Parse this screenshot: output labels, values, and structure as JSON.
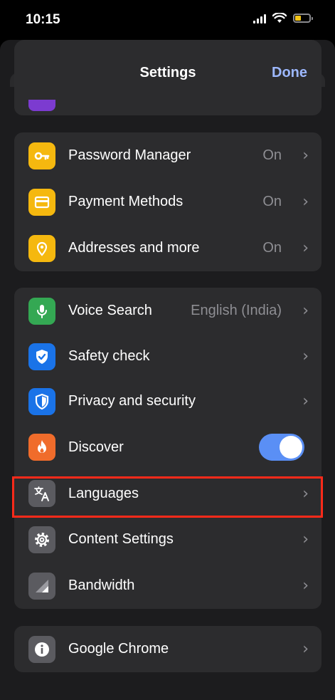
{
  "status_bar": {
    "time": "10:15",
    "battery_color": "#f5c518"
  },
  "nav": {
    "title": "Settings",
    "done_label": "Done"
  },
  "colors": {
    "sheet": "#1c1c1e",
    "group": "#2c2c2e",
    "accent": "#9db8ff",
    "highlight": "#ff2a1a"
  },
  "groups": [
    {
      "rows": [
        {
          "label": "Password Manager",
          "value": "On",
          "icon": "key-icon",
          "icon_color": "#f5b80f"
        },
        {
          "label": "Payment Methods",
          "value": "On",
          "icon": "credit-card-icon",
          "icon_color": "#f5b80f"
        },
        {
          "label": "Addresses and more",
          "value": "On",
          "icon": "location-pin-icon",
          "icon_color": "#f5b80f"
        }
      ]
    },
    {
      "rows": [
        {
          "label": "Voice Search",
          "value": "English (India)",
          "icon": "microphone-icon",
          "icon_color": "#34a853"
        },
        {
          "label": "Safety check",
          "value": "",
          "icon": "shield-check-icon",
          "icon_color": "#1a73e8"
        },
        {
          "label": "Privacy and security",
          "value": "",
          "icon": "shield-icon",
          "icon_color": "#1a73e8"
        },
        {
          "label": "Discover",
          "value": "",
          "icon": "flame-icon",
          "icon_color": "#f06c2b",
          "toggle_on": true
        },
        {
          "label": "Languages",
          "value": "",
          "icon": "translate-icon",
          "icon_color": "#5b5b60"
        },
        {
          "label": "Content Settings",
          "value": "",
          "icon": "gear-icon",
          "icon_color": "#5b5b60",
          "highlighted": true
        },
        {
          "label": "Bandwidth",
          "value": "",
          "icon": "signal-icon",
          "icon_color": "#5b5b60"
        }
      ]
    },
    {
      "rows": [
        {
          "label": "Google Chrome",
          "value": "",
          "icon": "info-icon",
          "icon_color": "#5b5b60"
        }
      ]
    }
  ]
}
